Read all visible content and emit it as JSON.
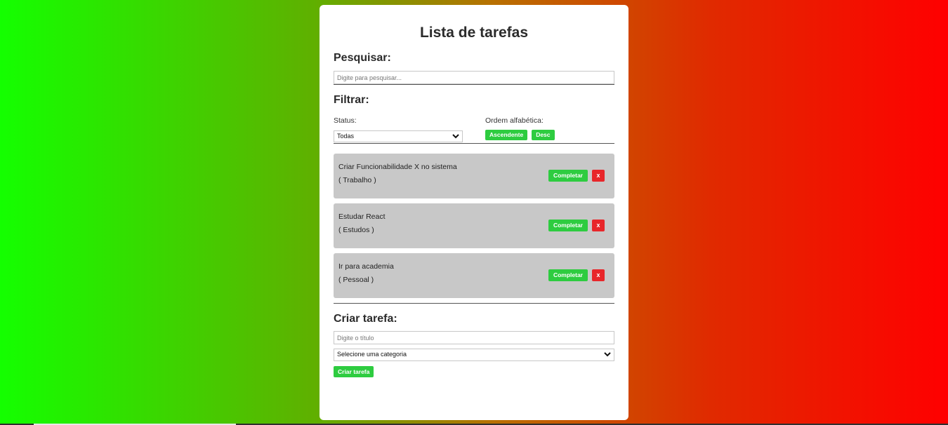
{
  "app": {
    "title": "Lista de tarefas"
  },
  "search": {
    "heading": "Pesquisar:",
    "placeholder": "Digite para pesquisar..."
  },
  "filter": {
    "heading": "Filtrar:",
    "status_label": "Status:",
    "status_value": "Todas",
    "order_label": "Ordem alfabética:",
    "asc_label": "Ascendente",
    "desc_label": "Desc"
  },
  "tasks": [
    {
      "title": "Criar Funcionabilidade X no sistema",
      "category": "( Trabalho )",
      "complete_label": "Completar",
      "delete_label": "x"
    },
    {
      "title": "Estudar React",
      "category": "( Estudos )",
      "complete_label": "Completar",
      "delete_label": "x"
    },
    {
      "title": "Ir para academia",
      "category": "( Pessoal )",
      "complete_label": "Completar",
      "delete_label": "x"
    }
  ],
  "create": {
    "heading": "Criar tarefa:",
    "title_placeholder": "Digite o título",
    "category_value": "Selecione uma categoria",
    "submit_label": "Criar tarefa"
  },
  "colors": {
    "accent_green": "#2ecc40",
    "danger_red": "#e8262a",
    "task_bg": "#c8c8c8"
  }
}
